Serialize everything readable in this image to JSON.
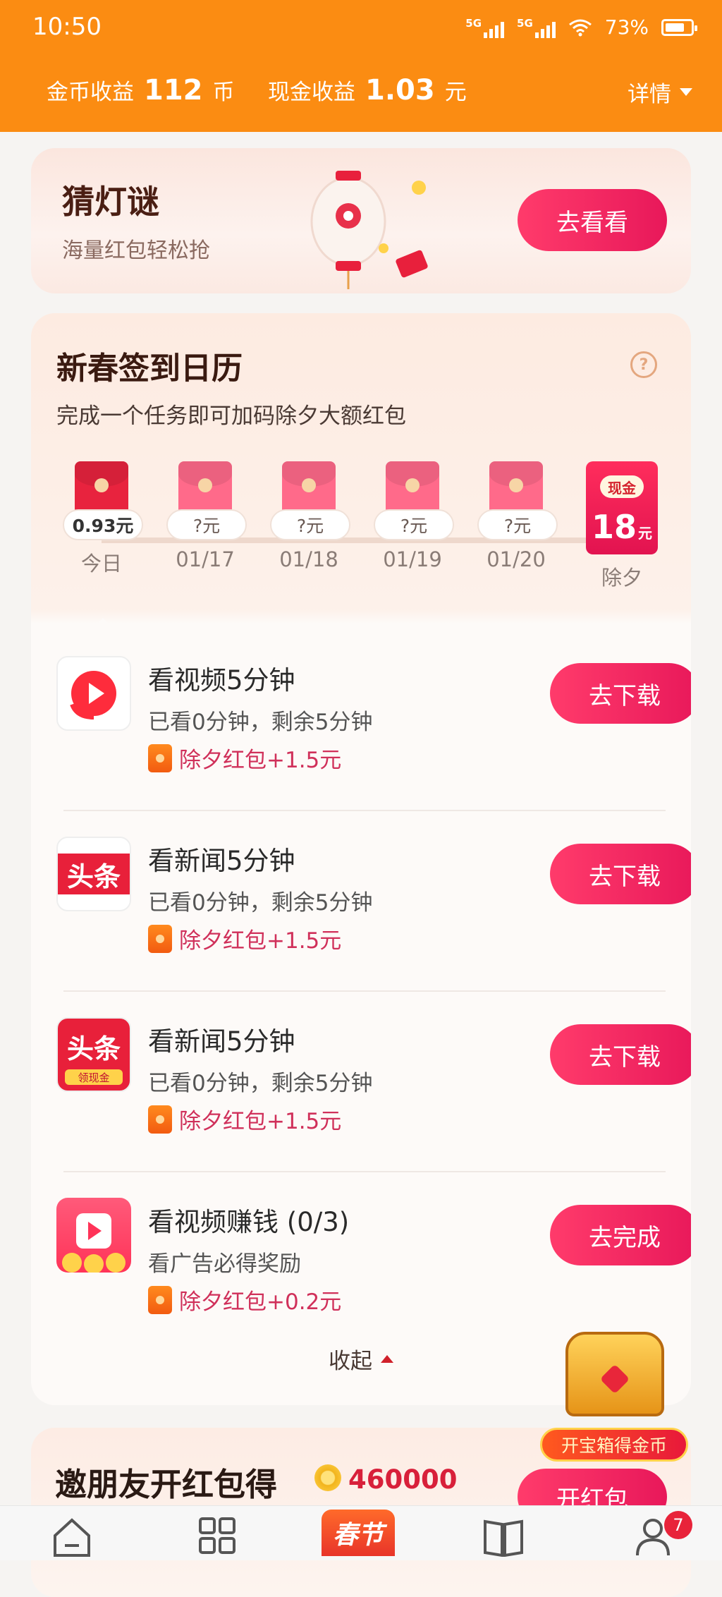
{
  "status_bar": {
    "time": "10:50",
    "network_1": "5G",
    "network_2": "5G",
    "battery": "73%"
  },
  "header": {
    "coin_label": "金币收益",
    "coin_value": "112",
    "coin_unit": "币",
    "cash_label": "现金收益",
    "cash_value": "1.03",
    "cash_unit": "元",
    "detail_label": "详情"
  },
  "riddle_card": {
    "title": "猜灯谜",
    "subtitle": "海量红包轻松抢",
    "button": "去看看"
  },
  "calendar": {
    "title": "新春签到日历",
    "subtitle": "完成一个任务即可加码除夕大额红包",
    "help_icon": "?",
    "days": [
      {
        "amount": "0.93元",
        "label": "今日"
      },
      {
        "amount": "?元",
        "label": "01/17"
      },
      {
        "amount": "?元",
        "label": "01/18"
      },
      {
        "amount": "?元",
        "label": "01/19"
      },
      {
        "amount": "?元",
        "label": "01/20"
      }
    ],
    "eve": {
      "tag": "现金",
      "value": "18",
      "unit": "元",
      "label": "除夕"
    }
  },
  "tasks": [
    {
      "app_icon": "xigua-video-icon",
      "title": "看视频5分钟",
      "progress": "已看0分钟，剩余5分钟",
      "reward": "除夕红包+1.5元",
      "button": "去下载"
    },
    {
      "app_icon": "toutiao-icon",
      "title": "看新闻5分钟",
      "progress": "已看0分钟，剩余5分钟",
      "reward": "除夕红包+1.5元",
      "button": "去下载"
    },
    {
      "app_icon": "toutiao-lite-icon",
      "title": "看新闻5分钟",
      "progress": "已看0分钟，剩余5分钟",
      "reward": "除夕红包+1.5元",
      "button": "去下载"
    },
    {
      "app_icon": "play-coins-icon",
      "title": "看视频赚钱 (0/3)",
      "progress": "看广告必得奖励",
      "reward": "除夕红包+0.2元",
      "button": "去完成"
    }
  ],
  "icon_texts": {
    "toutiao": "头条",
    "toutiao_lite": "头条",
    "toutiao_lite_sub": "领现金"
  },
  "collapse_label": "收起",
  "friend_card": {
    "title": "邀朋友开红包得",
    "amount": "460000",
    "button": "开红包"
  },
  "treasure_chest": {
    "label": "开宝箱得金币"
  },
  "tabbar": {
    "spring_tab": "春节",
    "profile_badge": "7"
  },
  "colors": {
    "brand_orange": "#fb8c12",
    "button_pink": "#ff3b6b",
    "reward_red": "#d0305a"
  }
}
